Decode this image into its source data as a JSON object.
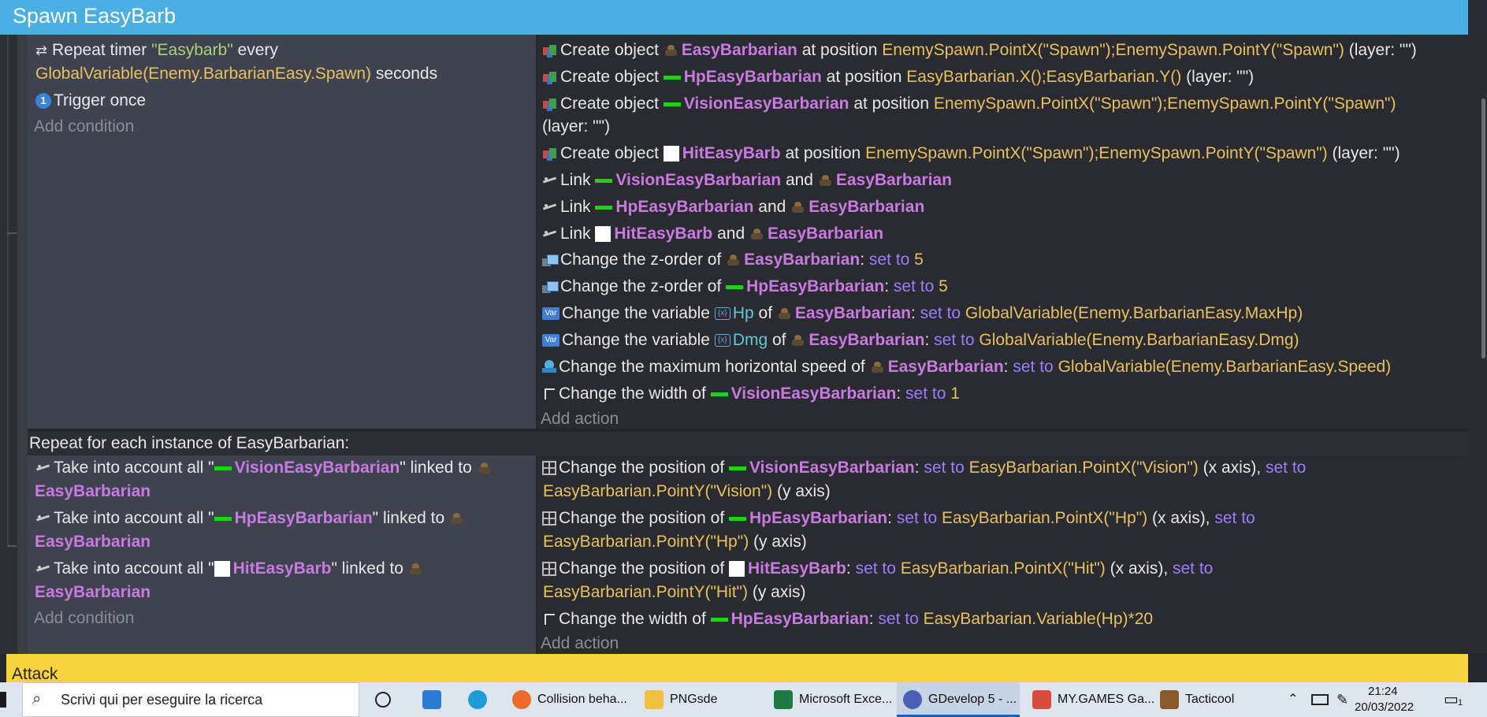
{
  "group": {
    "title": "Spawn EasyBarb",
    "next_title": "Attack"
  },
  "event1": {
    "conditions": {
      "timer": {
        "prefix": "Repeat timer",
        "name": "\"Easybarb\"",
        "every": "every",
        "expr": "GlobalVariable(Enemy.BarbarianEasy.Spawn)",
        "suffix": "seconds"
      },
      "trigger_once": "Trigger once",
      "add_condition": "Add condition"
    },
    "actions": {
      "create_label": "Create object",
      "at_position": "at position",
      "layer_empty": "(layer: \"\")",
      "a1": {
        "object": "EasyBarbarian",
        "pos": "EnemySpawn.PointX(\"Spawn\");EnemySpawn.PointY(\"Spawn\")"
      },
      "a2": {
        "object": "HpEasyBarbarian",
        "pos": "EasyBarbarian.X();EasyBarbarian.Y()"
      },
      "a3": {
        "object": "VisionEasyBarbarian",
        "pos": "EnemySpawn.PointX(\"Spawn\");EnemySpawn.PointY(\"Spawn\")"
      },
      "a4": {
        "object": "HitEasyBarb",
        "pos": "EnemySpawn.PointX(\"Spawn\");EnemySpawn.PointY(\"Spawn\")"
      },
      "link_label": "Link",
      "and": "and",
      "l1": {
        "a": "VisionEasyBarbarian",
        "b": "EasyBarbarian"
      },
      "l2": {
        "a": "HpEasyBarbarian",
        "b": "EasyBarbarian"
      },
      "l3": {
        "a": "HitEasyBarb",
        "b": "EasyBarbarian"
      },
      "zorder_label": "Change the z-order of",
      "set_to": "set to",
      "z1": {
        "object": "EasyBarbarian",
        "value": "5"
      },
      "z2": {
        "object": "HpEasyBarbarian",
        "value": "5"
      },
      "var_label": "Change the variable",
      "of": "of",
      "v1": {
        "var": "Hp",
        "object": "EasyBarbarian",
        "value": "GlobalVariable(Enemy.BarbarianEasy.MaxHp)"
      },
      "v2": {
        "var": "Dmg",
        "object": "EasyBarbarian",
        "value": "GlobalVariable(Enemy.BarbarianEasy.Dmg)"
      },
      "speed_label": "Change the maximum horizontal speed of",
      "speed": {
        "object": "EasyBarbarian",
        "value": "GlobalVariable(Enemy.BarbarianEasy.Speed)"
      },
      "width_label": "Change the width of",
      "w1": {
        "object": "VisionEasyBarbarian",
        "value": "1"
      },
      "add_action": "Add action"
    }
  },
  "event2": {
    "header": "Repeat for each instance of EasyBarbarian:",
    "conditions": {
      "take_label": "Take into account all \"",
      "linked_to": "\" linked to",
      "c1": {
        "object": "VisionEasyBarbarian",
        "target": "EasyBarbarian"
      },
      "c2": {
        "object": "HpEasyBarbarian",
        "target": "EasyBarbarian"
      },
      "c3": {
        "object": "HitEasyBarb",
        "target": "EasyBarbarian"
      },
      "add_condition": "Add condition"
    },
    "actions": {
      "pos_label": "Change the position of",
      "set_to": "set to",
      "x_axis": "(x axis),",
      "y_axis": "(y axis)",
      "p1": {
        "object": "VisionEasyBarbarian",
        "x": "EasyBarbarian.PointX(\"Vision\")",
        "y": "EasyBarbarian.PointY(\"Vision\")"
      },
      "p2": {
        "object": "HpEasyBarbarian",
        "x": "EasyBarbarian.PointX(\"Hp\")",
        "y": "EasyBarbarian.PointY(\"Hp\")"
      },
      "p3": {
        "object": "HitEasyBarb",
        "x": "EasyBarbarian.PointX(\"Hit\")",
        "y": "EasyBarbarian.PointY(\"Hit\")"
      },
      "width_label": "Change the width of",
      "w": {
        "object": "HpEasyBarbarian",
        "value": "EasyBarbarian.Variable(Hp)*20"
      },
      "add_action": "Add action"
    }
  },
  "taskbar": {
    "search_placeholder": "Scrivi qui per eseguire la ricerca",
    "apps": [
      {
        "label": "Collision beha..."
      },
      {
        "label": "PNGsde"
      },
      {
        "label": "Microsoft Exce..."
      },
      {
        "label": "GDevelop 5 - ..."
      },
      {
        "label": "MY.GAMES Ga..."
      },
      {
        "label": "Tacticool"
      }
    ],
    "time": "21:24",
    "date": "20/03/2022",
    "notification_count": "1"
  }
}
